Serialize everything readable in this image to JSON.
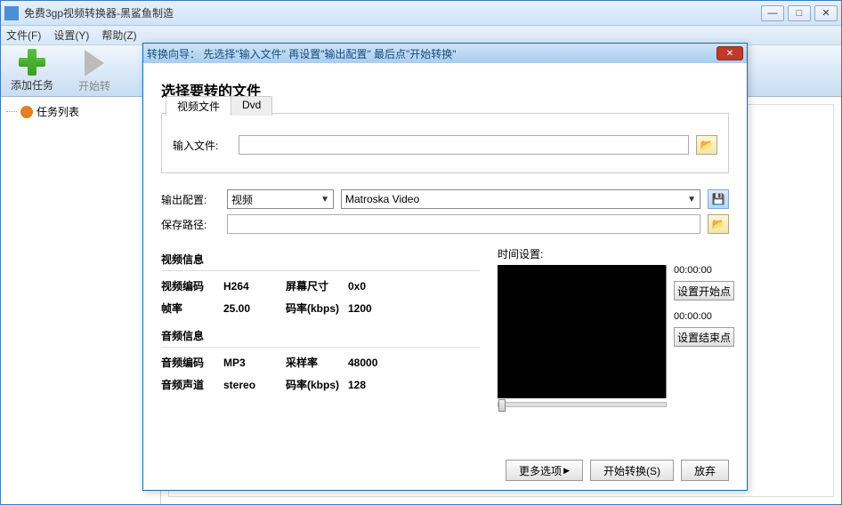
{
  "window": {
    "title": "免费3gp视频转换器-黑鲨鱼制造"
  },
  "menu": {
    "file": "文件(F)",
    "settings": "设置(Y)",
    "help": "帮助(Z)"
  },
  "toolbar": {
    "add_task": "添加任务",
    "start_convert": "开始转"
  },
  "sidebar": {
    "task_list": "任务列表"
  },
  "dialog": {
    "title": "转换向导： 先选择\"输入文件\"  再设置\"输出配置\"   最后点\"开始转换\"",
    "heading": "选择要转的文件",
    "tabs": {
      "video_file": "视频文件",
      "dvd": "Dvd"
    },
    "input_file_label": "输入文件:",
    "output_config_label": "输出配置:",
    "save_path_label": "保存路径:",
    "combo_video": "视频",
    "combo_format": "Matroska Video",
    "video_info_title": "视频信息",
    "audio_info_title": "音频信息",
    "fields": {
      "video_codec_label": "视频编码",
      "video_codec": "H264",
      "screen_size_label": "屏幕尺寸",
      "screen_size": "0x0",
      "fps_label": "帧率",
      "fps": "25.00",
      "vbitrate_label": "码率(kbps)",
      "vbitrate": "1200",
      "audio_codec_label": "音频编码",
      "audio_codec": "MP3",
      "sample_rate_label": "采样率",
      "sample_rate": "48000",
      "channels_label": "音频声道",
      "channels": "stereo",
      "abitrate_label": "码率(kbps)",
      "abitrate": "128"
    },
    "time_settings_label": "时间设置:",
    "time_start": "00:00:00",
    "time_end": "00:00:00",
    "set_start_btn": "设置开始点",
    "set_end_btn": "设置结束点",
    "more_options": "更多选项",
    "start_convert": "开始转换(S)",
    "abort": "放弃"
  }
}
